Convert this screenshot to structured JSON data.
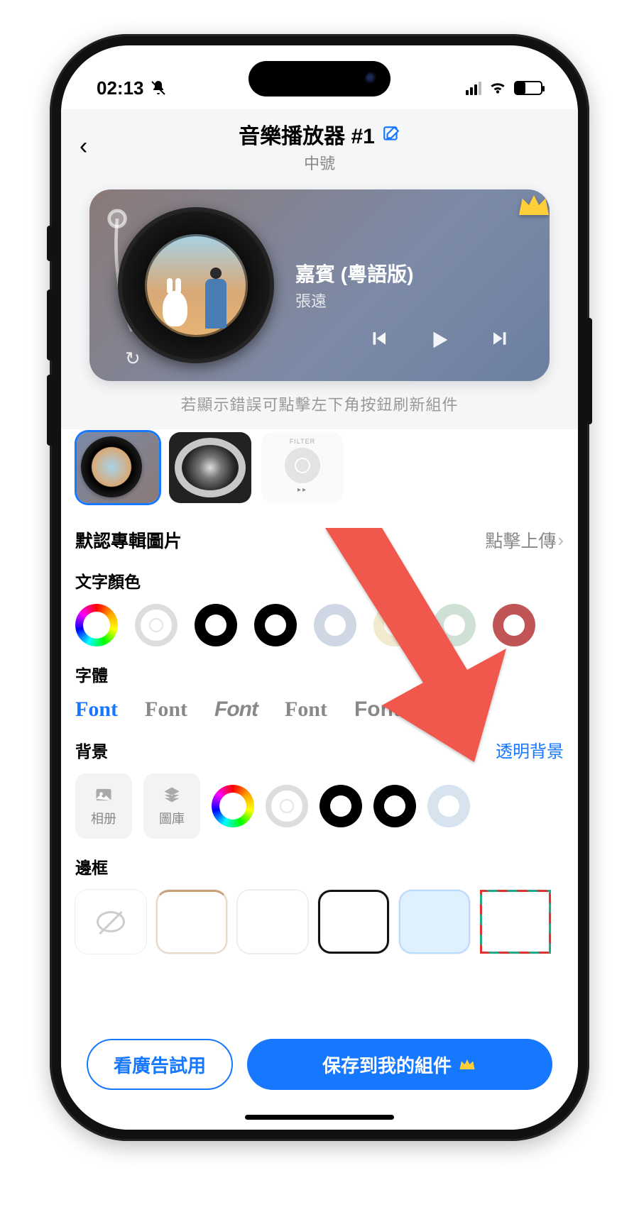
{
  "status": {
    "time": "02:13"
  },
  "header": {
    "title": "音樂播放器 #1",
    "subtitle": "中號"
  },
  "preview": {
    "track_title": "嘉賓 (粵語版)",
    "artist": "張遠",
    "hint": "若顯示錯誤可點擊左下角按鈕刷新組件"
  },
  "skins": {
    "ipod_label": "FILTER",
    "ipod_controls": "▸▸"
  },
  "sections": {
    "album": {
      "label": "默認專輯圖片",
      "action": "點擊上傳"
    },
    "text_color": {
      "label": "文字顏色"
    },
    "font": {
      "label": "字體",
      "sample": "Font"
    },
    "background": {
      "label": "背景",
      "link": "透明背景",
      "photo_btn": "相册",
      "library_btn": "圖庫"
    },
    "border": {
      "label": "邊框"
    }
  },
  "footer": {
    "trial": "看廣告試用",
    "save": "保存到我的組件"
  }
}
